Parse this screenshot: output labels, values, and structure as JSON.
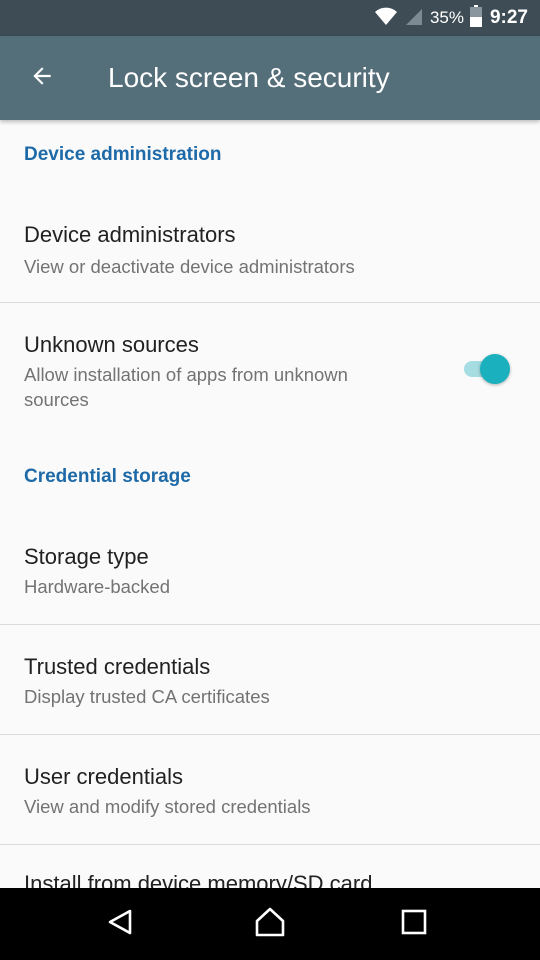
{
  "status_bar": {
    "battery_percent": "35%",
    "time": "9:27"
  },
  "app_bar": {
    "title": "Lock screen & security",
    "back_icon": "arrow-left-icon"
  },
  "sections": {
    "device_admin_header": "Device administration",
    "credential_storage_header": "Credential storage"
  },
  "items": {
    "device_administrators": {
      "title": "Device administrators",
      "summary": "View or deactivate device administrators"
    },
    "unknown_sources": {
      "title": "Unknown sources",
      "summary_line1": "Allow installation of apps from unknown",
      "summary_line2": "sources",
      "enabled": true
    },
    "storage_type": {
      "title": "Storage type",
      "summary": "Hardware-backed"
    },
    "trusted_credentials": {
      "title": "Trusted credentials",
      "summary": "Display trusted CA certificates"
    },
    "user_credentials": {
      "title": "User credentials",
      "summary": "View and modify stored credentials"
    },
    "install_from_storage": {
      "title": "Install from device memory/SD card"
    }
  },
  "colors": {
    "accent": "#1ab0be",
    "section_header": "#1e6aa8",
    "app_bar": "#546e7a",
    "status_bar": "#3e4c56"
  }
}
